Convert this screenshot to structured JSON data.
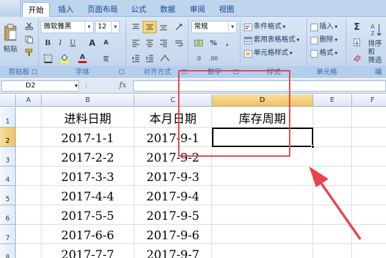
{
  "tabs": [
    {
      "label": "开始",
      "active": true
    },
    {
      "label": "插入"
    },
    {
      "label": "页面布局"
    },
    {
      "label": "公式"
    },
    {
      "label": "数据"
    },
    {
      "label": "审阅"
    },
    {
      "label": "视图"
    }
  ],
  "ribbon": {
    "clipboard": {
      "group_label": "剪贴板",
      "paste_label": "粘贴"
    },
    "font": {
      "group_label": "字体",
      "font_name": "微软雅黑",
      "font_size": "12",
      "bold": "B",
      "italic": "I",
      "underline": "U",
      "grow": "A",
      "shrink": "A",
      "font_color_letter": "A",
      "phonetic": "变"
    },
    "alignment": {
      "group_label": "对齐方式"
    },
    "number": {
      "group_label": "数字",
      "format": "常规",
      "currency": "%",
      "comma": ",",
      "inc_decimal": ".0",
      ".00": ".00"
    },
    "styles": {
      "group_label": "样式",
      "conditional": "条件格式",
      "table": "套用表格格式",
      "cell": "单元格样式"
    },
    "cells": {
      "group_label": "单元格",
      "insert": "插入",
      "delete": "删除",
      "format": "格式"
    },
    "editing": {
      "group_label": "编",
      "sigma": "Σ",
      "sort": "排序和",
      "filter": "筛选"
    }
  },
  "formula_bar": {
    "name_box": "D2",
    "fx": "fx",
    "formula": ""
  },
  "columns": [
    {
      "label": "A"
    },
    {
      "label": "B"
    },
    {
      "label": "C"
    },
    {
      "label": "D",
      "selected": true
    },
    {
      "label": "E"
    },
    {
      "label": "F"
    }
  ],
  "rows": [
    {
      "num": "1",
      "cells": [
        "",
        "进料日期",
        "本月日期",
        "库存周期",
        "",
        ""
      ]
    },
    {
      "num": "2",
      "selected": true,
      "cells": [
        "",
        "2017-1-1",
        "2017-9-1",
        "",
        "",
        ""
      ]
    },
    {
      "num": "3",
      "cells": [
        "",
        "2017-2-2",
        "2017-9-2",
        "",
        "",
        ""
      ]
    },
    {
      "num": "4",
      "cells": [
        "",
        "2017-3-3",
        "2017-9-3",
        "",
        "",
        ""
      ]
    },
    {
      "num": "5",
      "cells": [
        "",
        "2017-4-4",
        "2017-9-4",
        "",
        "",
        ""
      ]
    },
    {
      "num": "6",
      "cells": [
        "",
        "2017-5-5",
        "2017-9-5",
        "",
        "",
        ""
      ]
    },
    {
      "num": "7",
      "cells": [
        "",
        "2017-6-6",
        "2017-9-6",
        "",
        "",
        ""
      ]
    },
    {
      "num": "8",
      "cells": [
        "",
        "2017-7-7",
        "2017-9-7",
        "",
        "",
        ""
      ]
    }
  ],
  "active_cell": "D2",
  "colors": {
    "annotation_red": "#e8434a",
    "selection_header": "#f1c15f",
    "ribbon_blue": "#c7d9ef"
  }
}
